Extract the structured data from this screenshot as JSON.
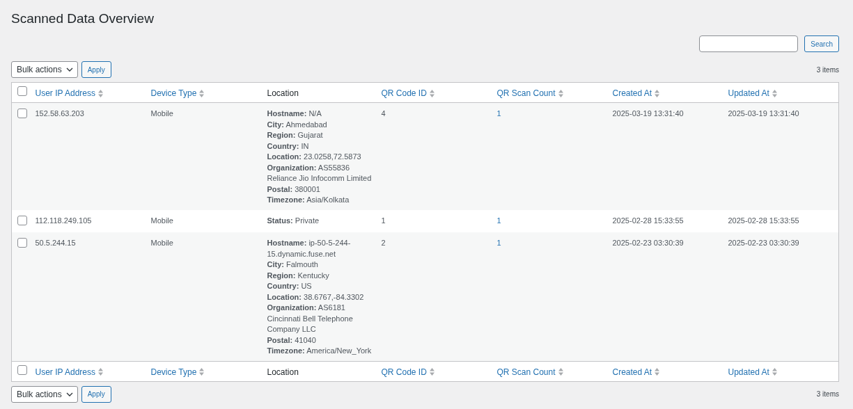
{
  "title": "Scanned Data Overview",
  "search": {
    "button": "Search"
  },
  "top_nav": {
    "bulk_action": "Bulk actions",
    "apply": "Apply",
    "count": "3 items"
  },
  "table": {
    "header_select_all": {
      "checked": false
    },
    "columns": [
      {
        "label": "User IP Address",
        "sortable": true
      },
      {
        "label": "Device Type",
        "sortable": true
      },
      {
        "label": "Location",
        "sortable": false
      },
      {
        "label": "QR Code ID",
        "sortable": true
      },
      {
        "label": "QR Scan Count",
        "sortable": true
      },
      {
        "label": "Created At",
        "sortable": true
      },
      {
        "label": "Updated At",
        "sortable": true
      }
    ],
    "rows": [
      {
        "checked": false,
        "ip": "152.58.63.203",
        "device": "Mobile",
        "location": [
          "**Hostname:** N/A",
          "**City:** Ahmedabad",
          "**Region:** Gujarat",
          "**Country:** IN",
          "**Location:** 23.0258,72.5873",
          "**Organization:** AS55836 Reliance Jio Infocomm Limited",
          "**Postal:** 380001",
          "**Timezone:** Asia/Kolkata"
        ],
        "qr_code_id": "4",
        "scan_count": "1",
        "created": "2025-03-19 13:31:40",
        "updated": "2025-03-19 13:31:40"
      },
      {
        "checked": false,
        "ip": "112.118.249.105",
        "device": "Mobile",
        "location": [
          "**Status:** Private"
        ],
        "qr_code_id": "1",
        "scan_count": "1",
        "created": "2025-02-28 15:33:55",
        "updated": "2025-02-28 15:33:55"
      },
      {
        "checked": false,
        "ip": "50.5.244.15",
        "device": "Mobile",
        "location": [
          "**Hostname:** ip-50-5-244-15.dynamic.fuse.net",
          "**City:** Falmouth",
          "**Region:** Kentucky",
          "**Country:** US",
          "**Location:** 38.6767,-84.3302",
          "**Organization:** AS6181 Cincinnati Bell Telephone Company LLC",
          "**Postal:** 41040",
          "**Timezone:** America/New_York"
        ],
        "qr_code_id": "2",
        "scan_count": "1",
        "created": "2025-02-23 03:30:39",
        "updated": "2025-02-23 03:30:39"
      }
    ],
    "footer_select_all": {
      "checked": false
    },
    "footer_columns": [
      {
        "label": "User IP Address",
        "sortable": true
      },
      {
        "label": "Device Type",
        "sortable": true
      },
      {
        "label": "Location",
        "sortable": false
      },
      {
        "label": "QR Code ID",
        "sortable": true
      },
      {
        "label": "QR Scan Count",
        "sortable": true
      },
      {
        "label": "Created At",
        "sortable": true
      },
      {
        "label": "Updated At",
        "sortable": true
      }
    ]
  },
  "bottom_nav": {
    "bulk_action": "Bulk actions",
    "apply": "Apply",
    "count": "3 items"
  }
}
